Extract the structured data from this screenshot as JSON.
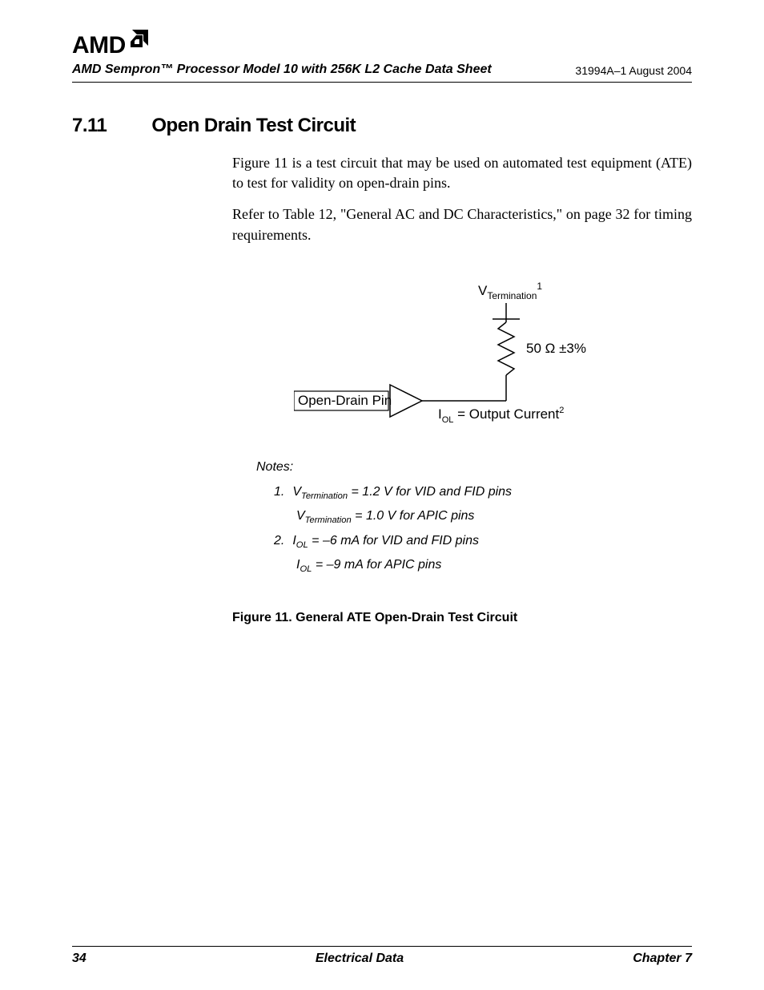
{
  "brand": {
    "text": "AMD",
    "icon": "◨"
  },
  "header": {
    "doc_title": "AMD Sempron™ Processor Model 10 with 256K L2 Cache Data Sheet",
    "doc_code": "31994A–1 August 2004"
  },
  "section": {
    "number": "7.11",
    "title": "Open Drain Test Circuit",
    "para1": "Figure 11 is a test circuit that may be used on automated test equipment (ATE) to test for validity on open-drain pins.",
    "para2": "Refer to Table 12, \"General AC and DC Characteristics,\" on page 32 for timing requirements."
  },
  "circuit": {
    "vterm_label_prefix": "V",
    "vterm_label_sub": "Termination",
    "vterm_label_sup": "1",
    "resistor_label": "50 Ω ±3%",
    "pin_label": "Open-Drain Pin",
    "iol_prefix": "I",
    "iol_sub": "OL",
    "iol_rest": " = Output Current",
    "iol_sup": "2"
  },
  "notes": {
    "heading": "Notes:",
    "n1_num": "1.",
    "n1a": {
      "pre": "V",
      "sub": "Termination",
      "rest": " = 1.2 V for VID and FID pins"
    },
    "n1b": {
      "pre": "V",
      "sub": "Termination",
      "rest": " = 1.0 V for APIC pins"
    },
    "n2_num": "2.",
    "n2a": {
      "pre": "I",
      "sub": "OL",
      "rest": " = –6 mA for VID and FID pins"
    },
    "n2b": {
      "pre": "I",
      "sub": "OL",
      "rest": " = –9 mA for APIC pins"
    }
  },
  "figure_caption": "Figure 11.   General ATE Open-Drain Test Circuit",
  "footer": {
    "page_number": "34",
    "center": "Electrical Data",
    "right": "Chapter 7"
  }
}
